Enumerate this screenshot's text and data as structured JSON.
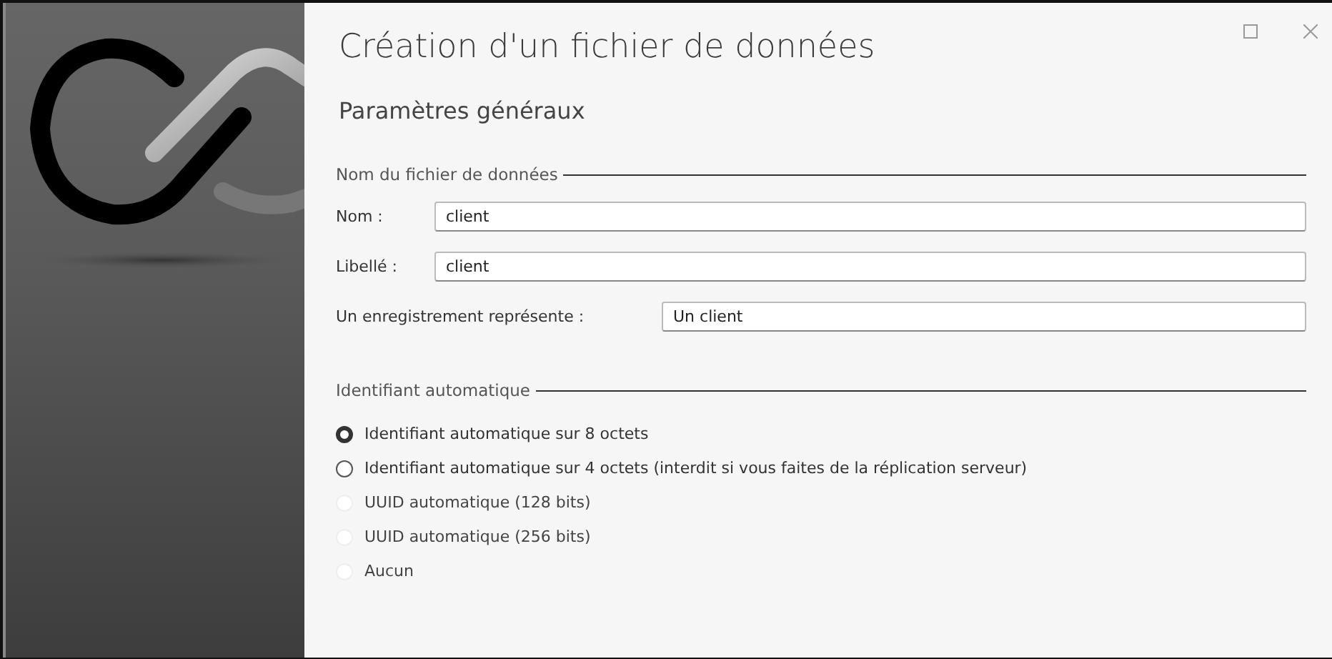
{
  "window": {
    "title": "Création d'un fichier de données"
  },
  "subtitle": "Paramètres généraux",
  "name_section": {
    "title": "Nom du fichier de données",
    "fields": [
      {
        "label": "Nom :",
        "value": "client",
        "kind": "short"
      },
      {
        "label": "Libellé :",
        "value": "client",
        "kind": "short"
      },
      {
        "label": "Un enregistrement représente :",
        "value": "Un client",
        "kind": "long"
      }
    ]
  },
  "id_section": {
    "title": "Identifiant automatique",
    "options": [
      {
        "label": "Identifiant automatique sur 8 octets",
        "selected": true,
        "disabled": false
      },
      {
        "label": "Identifiant automatique sur 4 octets (interdit si vous faites de la réplication serveur)",
        "selected": false,
        "disabled": false
      },
      {
        "label": "UUID automatique (128 bits)",
        "selected": false,
        "disabled": true
      },
      {
        "label": "UUID automatique (256 bits)",
        "selected": false,
        "disabled": true
      },
      {
        "label": "Aucun",
        "selected": false,
        "disabled": true
      }
    ]
  }
}
